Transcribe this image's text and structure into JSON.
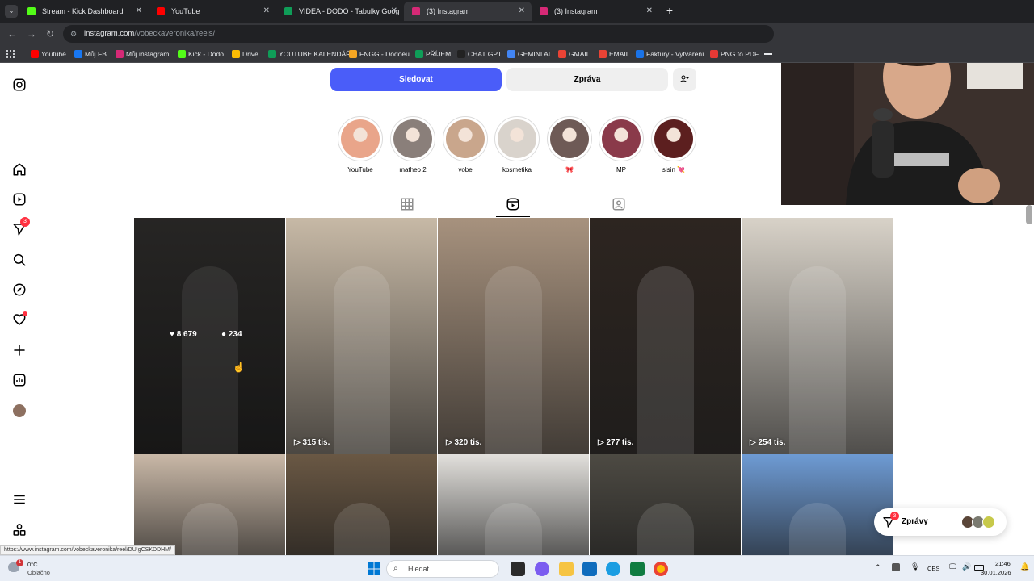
{
  "tabs": [
    {
      "title": "Stream - Kick Dashboard",
      "color": "#53fc18",
      "active": false
    },
    {
      "title": "YouTube",
      "color": "#ff0000",
      "active": false
    },
    {
      "title": "VIDEA - DODO - Tabulky Goog",
      "color": "#0f9d58",
      "active": false
    },
    {
      "title": "(3) Instagram",
      "color": "#d62976",
      "active": true
    },
    {
      "title": "(3) Instagram",
      "color": "#d62976",
      "active": false
    }
  ],
  "toolbar": {
    "url_host": "instagram.com",
    "url_path": "/vobeckaveronika/reels/"
  },
  "bookmarks": [
    {
      "label": "Youtube",
      "color": "#ff0000"
    },
    {
      "label": "Můj FB",
      "color": "#1877f2"
    },
    {
      "label": "Můj instagram",
      "color": "#d62976"
    },
    {
      "label": "Kick - Dodo",
      "color": "#53fc18"
    },
    {
      "label": "Drive",
      "color": "#fbbc04"
    },
    {
      "label": "YOUTUBE KALENDÁŘ",
      "color": "#0f9d58"
    },
    {
      "label": "FNGG - Dodoeu",
      "color": "#f5a623"
    },
    {
      "label": "PŘÍJEM",
      "color": "#0f9d58"
    },
    {
      "label": "CHAT GPT",
      "color": "#222222"
    },
    {
      "label": "GEMINI AI",
      "color": "#4285f4"
    },
    {
      "label": "GMAIL",
      "color": "#ea4335"
    },
    {
      "label": "EMAIL",
      "color": "#ea4335"
    },
    {
      "label": "Faktury - Vytváření",
      "color": "#1a73e8"
    },
    {
      "label": "PNG to PDF",
      "color": "#e53935"
    }
  ],
  "leftnav": {
    "notification_count": "3"
  },
  "profile": {
    "follow_label": "Sledovat",
    "message_label": "Zpráva"
  },
  "highlights": [
    {
      "label": "YouTube",
      "color": "#e9a58a"
    },
    {
      "label": "matheo 2",
      "color": "#8a7f7a"
    },
    {
      "label": "vobe",
      "color": "#c9a68c"
    },
    {
      "label": "kosmetika",
      "color": "#d9d3cc"
    },
    {
      "label": "🎀",
      "color": "#6e5a56"
    },
    {
      "label": "MP",
      "color": "#8a3a4a"
    },
    {
      "label": "sisin 💘",
      "color": "#5c1f1f"
    }
  ],
  "reels": [
    {
      "views": "",
      "likes": "8 679",
      "comments": "234",
      "hovered": true,
      "bg": "#3c3a38"
    },
    {
      "views": "315 tis.",
      "hovered": false,
      "bg": "#c7b9a6"
    },
    {
      "views": "320 tis.",
      "hovered": false,
      "bg": "#a7927e"
    },
    {
      "views": "277 tis.",
      "hovered": false,
      "bg": "#2d2520"
    },
    {
      "views": "254 tis.",
      "hovered": false,
      "bg": "#d8d2c8"
    },
    {
      "views": "",
      "hovered": false,
      "bg": "#c9b8a7"
    },
    {
      "views": "",
      "hovered": false,
      "bg": "#6a5844"
    },
    {
      "views": "",
      "hovered": false,
      "bg": "#e2e0dc"
    },
    {
      "views": "",
      "hovered": false,
      "bg": "#4d4a43"
    },
    {
      "views": "",
      "hovered": false,
      "bg": "#6e9bd4"
    }
  ],
  "messages": {
    "label": "Zprávy",
    "badge": "3"
  },
  "status_url": "https://www.instagram.com/vobeckaveronika/reel/DUIgCSKDDHM/",
  "taskbar": {
    "weather_temp": "0°C",
    "weather_desc": "Oblačno",
    "weather_badge": "1",
    "search_placeholder": "Hledat",
    "lang": "CES",
    "time": "21:46",
    "date": "30.01.2026"
  }
}
